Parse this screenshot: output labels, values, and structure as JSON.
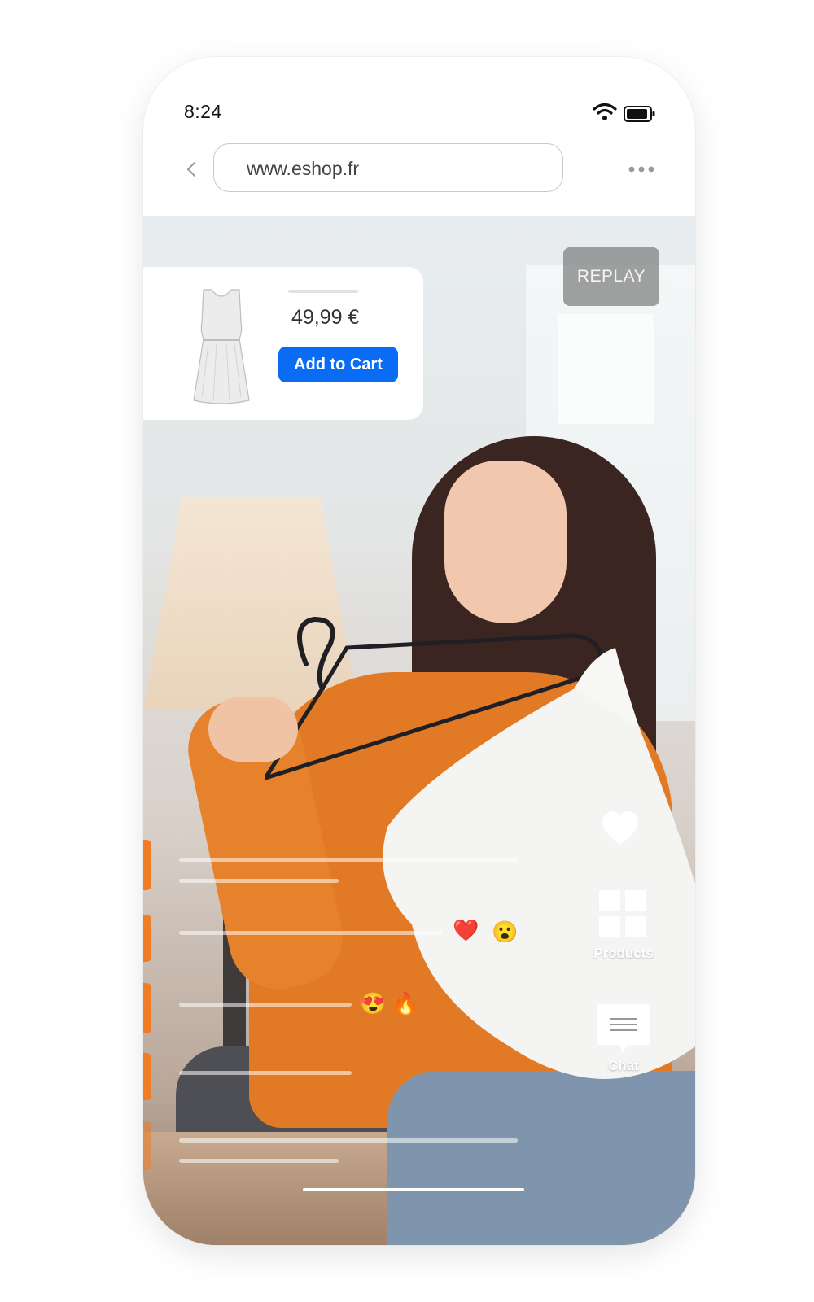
{
  "status_bar": {
    "time": "8:24"
  },
  "browser": {
    "url": "www.eshop.fr"
  },
  "product": {
    "price": "49,99 €",
    "add_to_cart_label": "Add to Cart"
  },
  "replay_label": "REPLAY",
  "reactions": {
    "first": [
      "❤️",
      "😮"
    ],
    "second": [
      "😍",
      "🔥"
    ]
  },
  "side_actions": {
    "products_label": "Products",
    "chat_label": "Chat"
  },
  "colors": {
    "accent": "#f07c25",
    "button": "#0a6cf5"
  }
}
